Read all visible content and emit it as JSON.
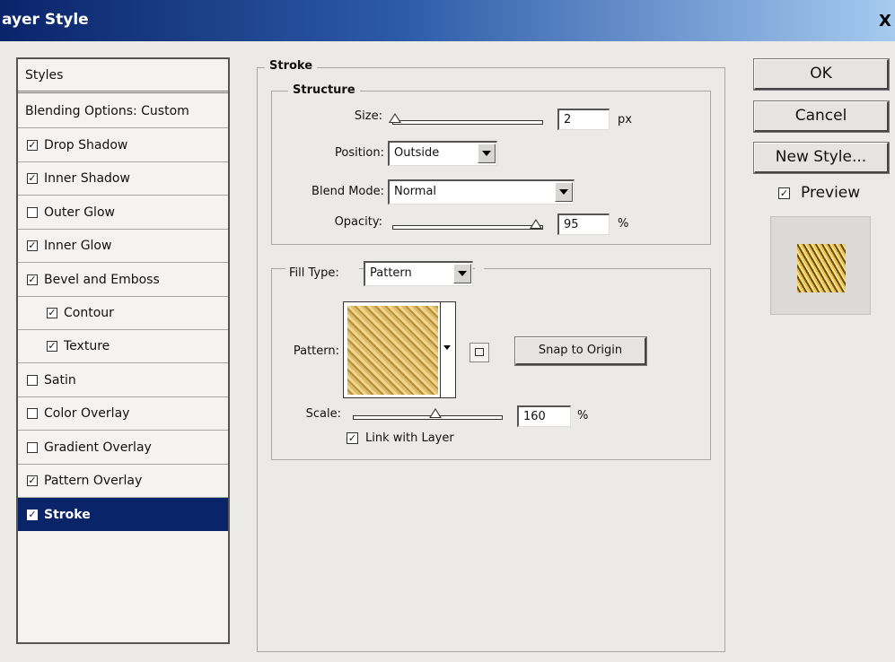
{
  "window": {
    "title": "ayer Style",
    "close_label": "X"
  },
  "styles_panel": {
    "header": "Styles",
    "blending_options": "Blending Options: Custom",
    "items": [
      {
        "label": "Drop Shadow",
        "checked": true
      },
      {
        "label": "Inner Shadow",
        "checked": true
      },
      {
        "label": "Outer Glow",
        "checked": false
      },
      {
        "label": "Inner Glow",
        "checked": true
      },
      {
        "label": "Bevel and Emboss",
        "checked": true
      },
      {
        "label": "Contour",
        "checked": true,
        "indent": true
      },
      {
        "label": "Texture",
        "checked": true,
        "indent": true
      },
      {
        "label": "Satin",
        "checked": false
      },
      {
        "label": "Color Overlay",
        "checked": false
      },
      {
        "label": "Gradient Overlay",
        "checked": false
      },
      {
        "label": "Pattern Overlay",
        "checked": true
      },
      {
        "label": "Stroke",
        "checked": true,
        "selected": true
      }
    ],
    "check_mark": "✓"
  },
  "stroke": {
    "title": "Stroke",
    "structure": {
      "title": "Structure",
      "size_label": "Size:",
      "size_value": "2",
      "size_unit": "px",
      "size_level": 0.02,
      "position_label": "Position:",
      "position_value": "Outside",
      "blend_mode_label": "Blend Mode:",
      "blend_mode_value": "Normal",
      "opacity_label": "Opacity:",
      "opacity_value": "95",
      "opacity_unit": "%",
      "opacity_level": 0.95
    },
    "fill": {
      "fill_type_label": "Fill Type:",
      "fill_type_value": "Pattern",
      "pattern_label": "Pattern:",
      "snap_label": "Snap to Origin",
      "scale_label": "Scale:",
      "scale_value": "160",
      "scale_unit": "%",
      "scale_level": 0.55,
      "link_label": "Link with Layer",
      "link_checked": true
    }
  },
  "actions": {
    "ok": "OK",
    "cancel": "Cancel",
    "new_style": "New Style...",
    "preview_label": "Preview",
    "preview_checked": true
  }
}
